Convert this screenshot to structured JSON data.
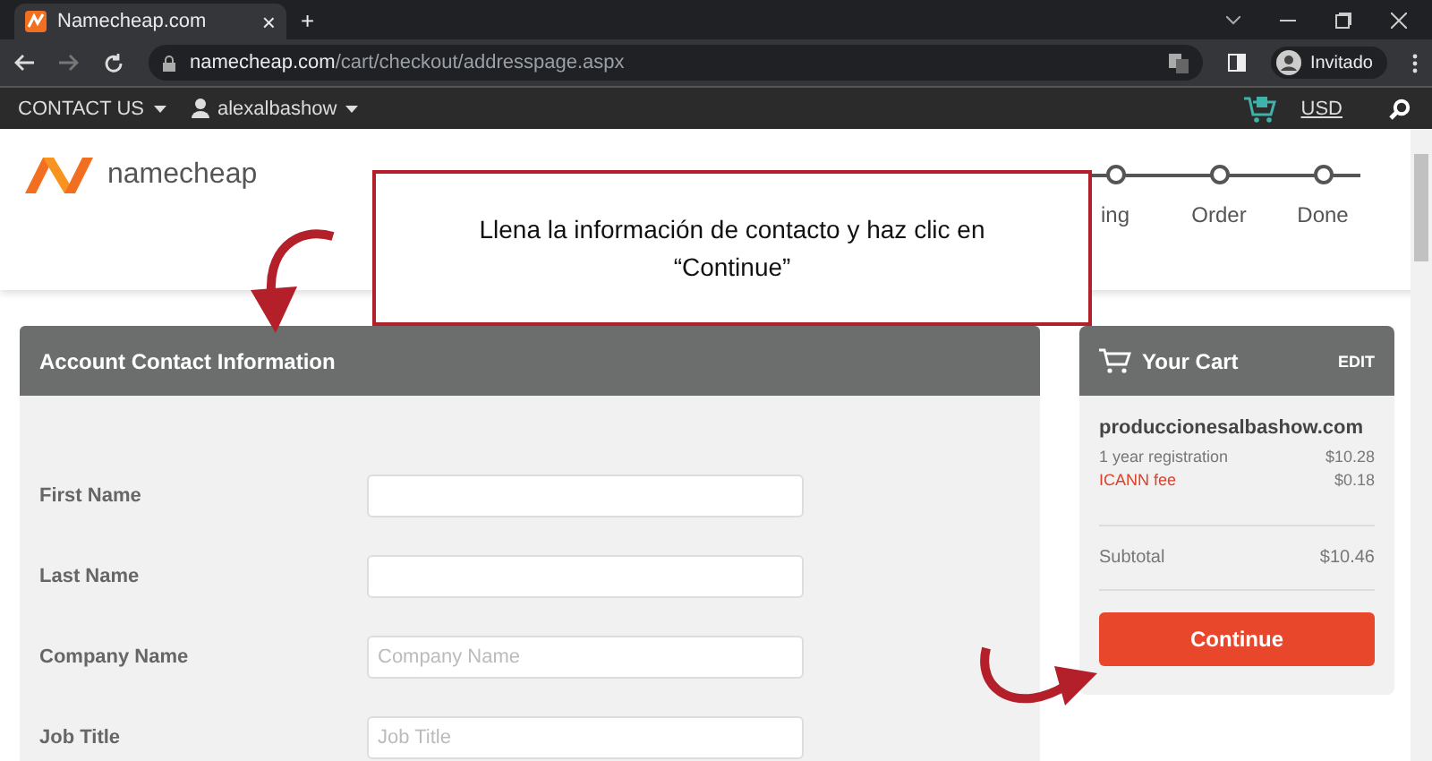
{
  "browser": {
    "tab": {
      "title": "Namecheap.com",
      "close": "×"
    },
    "new_tab": "+",
    "url": {
      "domain": "namecheap.com",
      "path": "/cart/checkout/addresspage.aspx"
    },
    "profile": "Invitado"
  },
  "site_nav": {
    "contact": "CONTACT US",
    "user": "alexalbashow",
    "currency": "USD"
  },
  "header": {
    "logo": "namecheap",
    "steps": [
      {
        "label": "ing",
        "done": false
      },
      {
        "label": "Order",
        "done": false
      },
      {
        "label": "Done",
        "done": false
      }
    ]
  },
  "callout": {
    "text": "Llena la información de contacto y haz clic en “Continue”"
  },
  "form": {
    "title": "Account Contact Information",
    "fields": [
      {
        "label": "First Name"
      },
      {
        "label": "Last Name"
      },
      {
        "label": "Company Name",
        "placeholder": "Company Name"
      },
      {
        "label": "Job Title",
        "placeholder": "Job Title"
      }
    ]
  },
  "cart": {
    "title": "Your Cart",
    "edit": "EDIT",
    "domain": "produccionesalbashow.com",
    "lines": [
      {
        "label": "1 year registration",
        "amount": "$10.28",
        "kind": "normal"
      },
      {
        "label": "ICANN fee",
        "amount": "$0.18",
        "kind": "fee"
      }
    ],
    "subtotal": {
      "label": "Subtotal",
      "amount": "$10.46"
    },
    "button": "Continue"
  }
}
